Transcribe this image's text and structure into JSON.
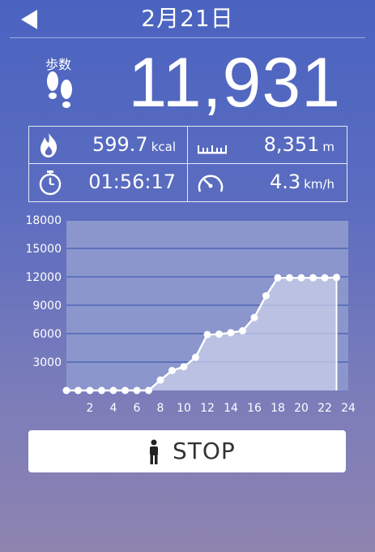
{
  "header": {
    "date": "2月21日"
  },
  "steps": {
    "label": "歩数",
    "value": "11,931"
  },
  "stats": {
    "calories": {
      "value": "599.7",
      "unit": "kcal"
    },
    "distance": {
      "value": "8,351",
      "unit": "m"
    },
    "duration": {
      "value": "01:56:17"
    },
    "speed": {
      "value": "4.3",
      "unit": "km/h"
    }
  },
  "chart_data": {
    "type": "area",
    "title": "",
    "xlabel": "",
    "ylabel": "",
    "x_ticks": [
      "2",
      "4",
      "6",
      "8",
      "10",
      "12",
      "14",
      "16",
      "18",
      "20",
      "22",
      "24"
    ],
    "y_ticks": [
      "3000",
      "6000",
      "9000",
      "12000",
      "15000",
      "18000"
    ],
    "xlim": [
      0,
      24
    ],
    "ylim": [
      0,
      18000
    ],
    "grid": true,
    "series": [
      {
        "x": [
          0,
          1,
          2,
          3,
          4,
          5,
          6,
          7,
          8,
          9,
          10,
          11,
          12,
          13,
          14,
          15,
          16,
          17,
          18,
          19,
          20,
          21,
          22,
          23
        ],
        "values": [
          0,
          0,
          0,
          0,
          0,
          0,
          0,
          0,
          1100,
          2100,
          2500,
          3500,
          5900,
          5950,
          6100,
          6300,
          7700,
          10000,
          11900,
          11900,
          11900,
          11900,
          11900,
          11931
        ]
      }
    ],
    "colors": {
      "line": "#ffffff",
      "fill": "#c9cfe8",
      "plot_bg": "#8b96cd",
      "grid": "#5066b6"
    }
  },
  "buttons": {
    "stop_label": "STOP"
  }
}
